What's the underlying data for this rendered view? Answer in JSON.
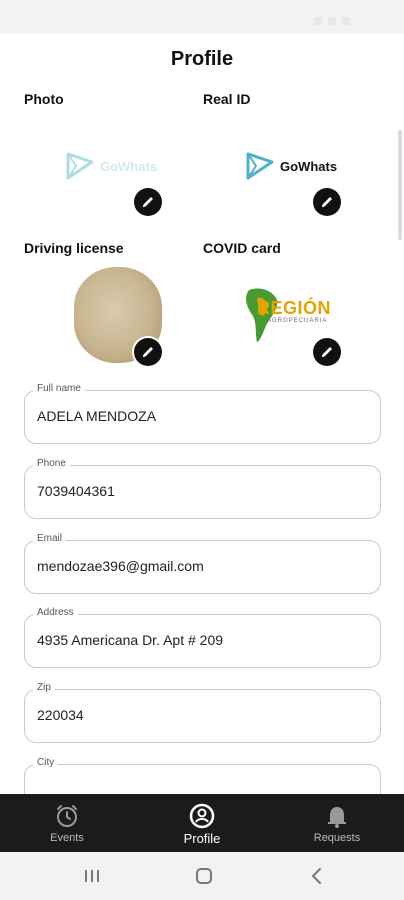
{
  "status": {
    "time": ""
  },
  "page": {
    "title": "Profile"
  },
  "documents": [
    {
      "label": "Photo",
      "logo_text": "GoWhats",
      "icon": "gowhats-logo"
    },
    {
      "label": "Real ID",
      "logo_text": "GoWhats",
      "icon": "gowhats-logo"
    },
    {
      "label": "Driving license",
      "icon": "document-image"
    },
    {
      "label": "COVID card",
      "logo_text": "REGIÓN",
      "logo_subtext": "AGROPECUARIA",
      "icon": "region-logo"
    }
  ],
  "fields": [
    {
      "label": "Full name",
      "value": "ADELA MENDOZA"
    },
    {
      "label": "Phone",
      "value": "7039404361"
    },
    {
      "label": "Email",
      "value": "mendozae396@gmail.com"
    },
    {
      "label": "Address",
      "value": "4935 Americana Dr. Apt # 209"
    },
    {
      "label": "Zip",
      "value": "220034"
    },
    {
      "label": "City",
      "value": ""
    }
  ],
  "nav": [
    {
      "label": "Events",
      "icon": "alarm-clock-icon"
    },
    {
      "label": "Profile",
      "icon": "user-circle-icon",
      "active": true
    },
    {
      "label": "Requests",
      "icon": "bell-icon"
    }
  ],
  "colors": {
    "accent": "#4fb3c4",
    "nav_bg": "#1b1b1b",
    "region_gold": "#e1a400"
  }
}
